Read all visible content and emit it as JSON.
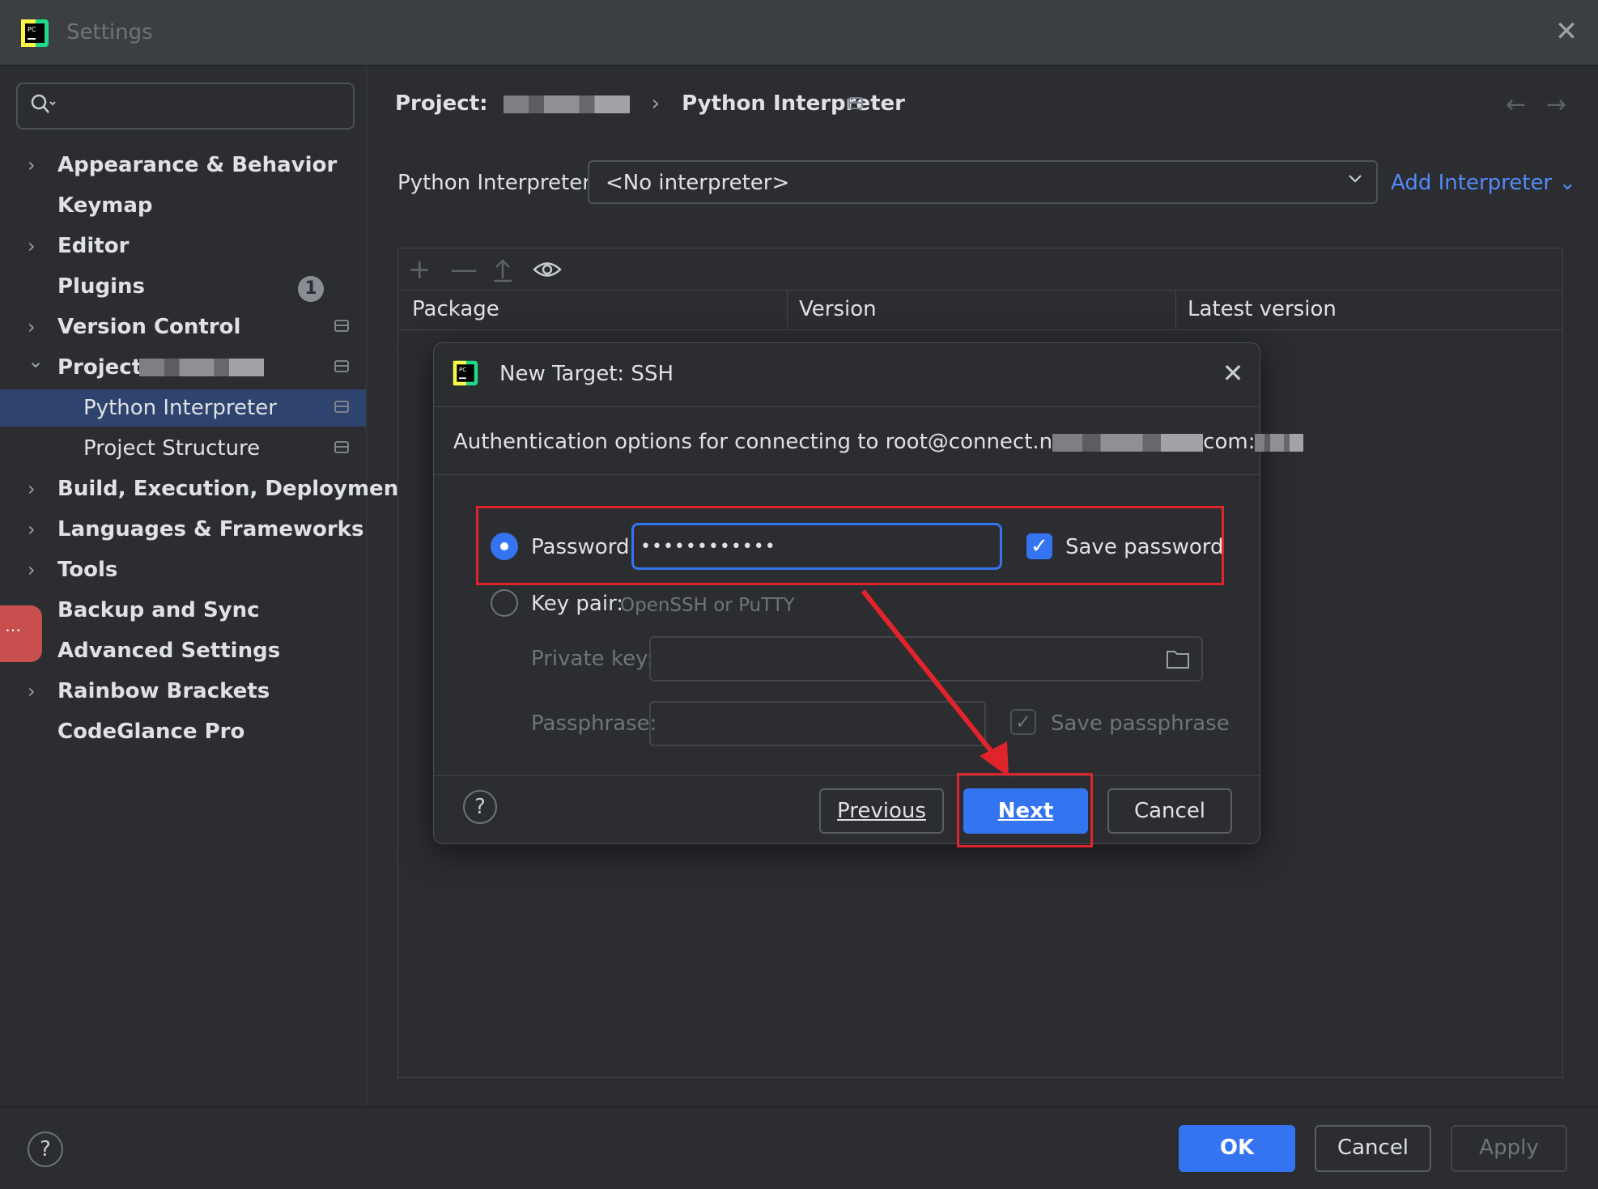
{
  "window": {
    "title": "Settings",
    "close_glyph": "✕"
  },
  "sidebar": {
    "search_placeholder": "",
    "items": [
      {
        "label": "Appearance & Behavior",
        "expandable": true
      },
      {
        "label": "Keymap",
        "expandable": false
      },
      {
        "label": "Editor",
        "expandable": true
      },
      {
        "label": "Plugins",
        "expandable": false,
        "badge": "1"
      },
      {
        "label": "Version Control",
        "expandable": true
      },
      {
        "label": "Project:",
        "expandable": true,
        "expanded": true
      },
      {
        "label": "Python Interpreter",
        "sub": true,
        "selected": true
      },
      {
        "label": "Project Structure",
        "sub": true
      },
      {
        "label": "Build, Execution, Deployment",
        "expandable": true
      },
      {
        "label": "Languages & Frameworks",
        "expandable": true
      },
      {
        "label": "Tools",
        "expandable": true
      },
      {
        "label": "Backup and Sync",
        "expandable": false
      },
      {
        "label": "Advanced Settings",
        "expandable": false
      },
      {
        "label": "Rainbow Brackets",
        "expandable": true
      },
      {
        "label": "CodeGlance Pro",
        "expandable": false
      }
    ],
    "handle_glyph": "⋯"
  },
  "header": {
    "breadcrumb_project": "Project:",
    "breadcrumb_separator": "›",
    "breadcrumb_current": "Python Interpreter",
    "back_glyph": "←",
    "forward_glyph": "→"
  },
  "interpreter": {
    "label": "Python Interpreter:",
    "value": "<No interpreter>",
    "add_label": "Add Interpreter ⌄"
  },
  "packages": {
    "add_glyph": "+",
    "remove_glyph": "—",
    "columns": [
      "Package",
      "Version",
      "Latest version"
    ]
  },
  "dialog": {
    "title": "New Target: SSH",
    "close_glyph": "✕",
    "description": "Authentication options for connecting to root@connect.n",
    "description_tail": "com:",
    "password_label": "Password:",
    "password_value": "••••••••••••",
    "password_selected": true,
    "save_password_label": "Save password",
    "save_password_checked": true,
    "keypair_label": "Key pair:",
    "keypair_hint": "OpenSSH or PuTTY",
    "private_key_label": "Private key:",
    "passphrase_label": "Passphrase:",
    "save_passphrase_label": "Save passphrase",
    "help_glyph": "?",
    "previous_label": "Previous",
    "next_label": "Next",
    "cancel_label": "Cancel"
  },
  "footer": {
    "help_glyph": "?",
    "ok_label": "OK",
    "cancel_label": "Cancel",
    "apply_label": "Apply"
  },
  "colors": {
    "accent": "#3574f0",
    "annotation_red": "#e0242b",
    "link": "#548af7",
    "background": "#2b2d30"
  }
}
